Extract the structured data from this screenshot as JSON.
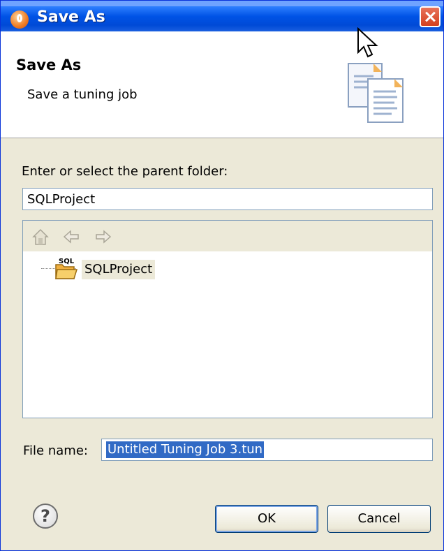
{
  "window": {
    "title": "Save As"
  },
  "banner": {
    "title": "Save As",
    "subtitle": "Save a tuning job",
    "icon": "documents-icon"
  },
  "parent_folder": {
    "label": "Enter or select the parent folder:",
    "value": "SQLProject"
  },
  "tree": {
    "toolbar": [
      "home-icon",
      "back-arrow-icon",
      "forward-arrow-icon"
    ],
    "items": [
      {
        "label": "SQLProject",
        "icon_text": "SQL",
        "selected": true
      }
    ]
  },
  "file_name": {
    "label": "File name:",
    "value": "Untitled Tuning Job 3.tun"
  },
  "buttons": {
    "help": "?",
    "ok": "OK",
    "cancel": "Cancel"
  },
  "colors": {
    "titlebar": "#0053e6",
    "selection": "#316ac5",
    "dialog_bg": "#ece9d8"
  }
}
